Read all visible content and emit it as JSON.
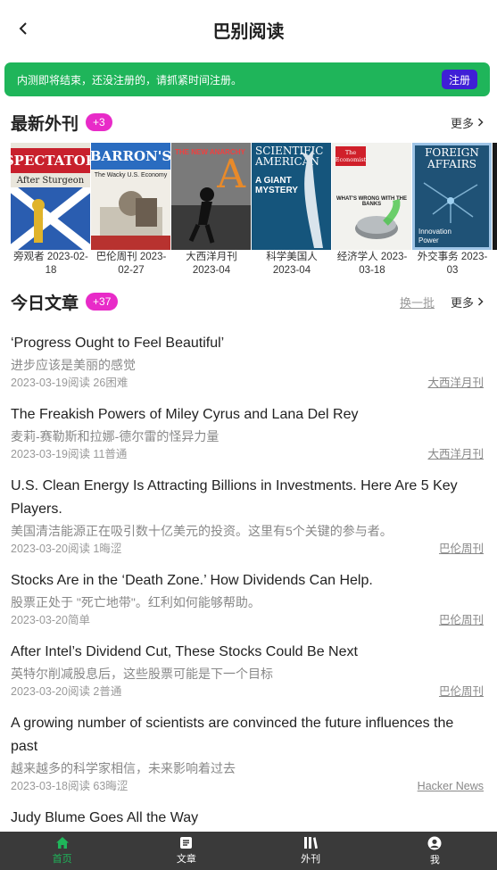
{
  "header": {
    "title": "巴别阅读"
  },
  "banner": {
    "text": "内测即将结束，还没注册的，请抓紧时间注册。",
    "button": "注册"
  },
  "magazines_section": {
    "title": "最新外刊",
    "badge": "+3",
    "more": "更多",
    "items": [
      {
        "caption": "旁观者 2023-02-18",
        "cover_text": "SPECTATOR",
        "cover_sub": "After Sturgeon"
      },
      {
        "caption": "巴伦周刊 2023-02-27",
        "cover_text": "BARRON'S",
        "cover_sub": "The Wacky U.S. Economy"
      },
      {
        "caption": "大西洋月刊 2023-04",
        "cover_text": "THE NEW ANARCHY",
        "cover_sub": "A"
      },
      {
        "caption": "科学美国人 2023-04",
        "cover_text": "SCIENTIFIC AMERICAN",
        "cover_sub": "A GIANT MYSTERY"
      },
      {
        "caption": "经济学人 2023-03-18",
        "cover_text": "The Economist",
        "cover_sub": "WHAT'S WRONG WITH THE BANKS"
      },
      {
        "caption": "外交事务 2023-03",
        "cover_text": "FOREIGN AFFAIRS",
        "cover_sub": "Innovation Power"
      }
    ]
  },
  "articles_section": {
    "title": "今日文章",
    "badge": "+37",
    "swap": "换一批",
    "more": "更多",
    "items": [
      {
        "title": "‘Progress Ought to Feel Beautiful’",
        "subtitle": "进步应该是美丽的感觉",
        "meta": "2023-03-19阅读 26困难",
        "source": "大西洋月刊"
      },
      {
        "title": "The Freakish Powers of Miley Cyrus and Lana Del Rey",
        "subtitle": "麦莉-赛勒斯和拉娜-德尔雷的怪异力量",
        "meta": "2023-03-19阅读 11普通",
        "source": "大西洋月刊"
      },
      {
        "title": "U.S. Clean Energy Is Attracting Billions in Investments. Here Are 5 Key Players.",
        "subtitle": "美国清洁能源正在吸引数十亿美元的投资。这里有5个关键的参与者。",
        "meta": "2023-03-20阅读 1晦涩",
        "source": "巴伦周刊"
      },
      {
        "title": "Stocks Are in the ‘Death Zone.’ How Dividends Can Help.",
        "subtitle": "股票正处于 \"死亡地带\"。红利如何能够帮助。",
        "meta": "2023-03-20简单",
        "source": "巴伦周刊"
      },
      {
        "title": "After Intel’s Dividend Cut, These Stocks Could Be Next",
        "subtitle": "英特尔削减股息后，这些股票可能是下一个目标",
        "meta": "2023-03-20阅读 2普通",
        "source": "巴伦周刊"
      },
      {
        "title": "A growing number of scientists are convinced the future influences the past",
        "subtitle": "越来越多的科学家相信，未来影响着过去",
        "meta": "2023-03-18阅读 63晦涩",
        "source": "Hacker News"
      },
      {
        "title": "Judy Blume Goes All the Way",
        "subtitle": "",
        "meta": "",
        "source": ""
      }
    ]
  },
  "tabbar": {
    "tabs": [
      {
        "label": "首页",
        "icon": "home-icon"
      },
      {
        "label": "文章",
        "icon": "article-icon"
      },
      {
        "label": "外刊",
        "icon": "magazines-icon"
      },
      {
        "label": "我",
        "icon": "profile-icon"
      }
    ]
  },
  "colors": {
    "accent_green": "#1fb55a",
    "badge_pink": "#e82bc8",
    "register_button": "#3f1fd6",
    "tabbar": "#3a3a3a"
  }
}
